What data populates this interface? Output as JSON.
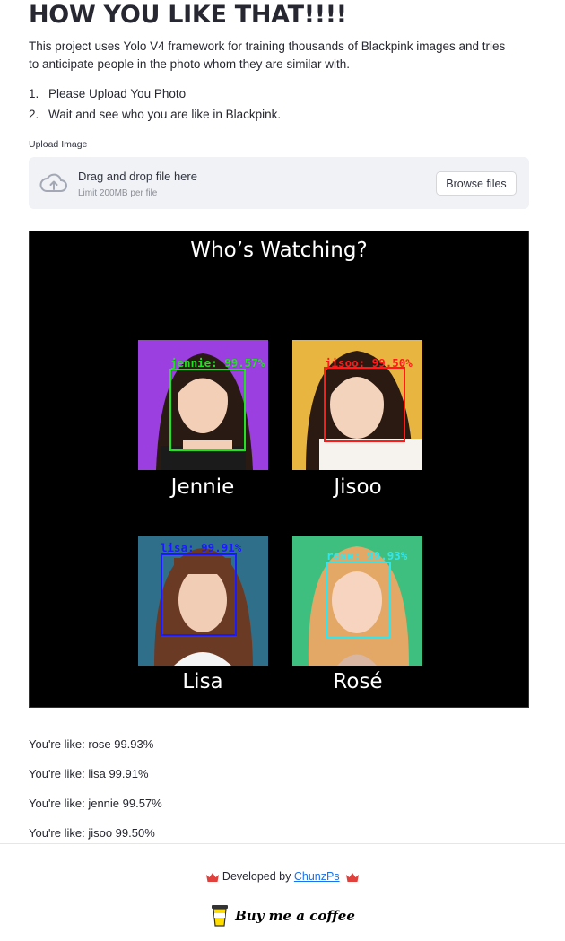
{
  "header": {
    "title": "HOW YOU LIKE THAT!!!!",
    "description": "This project uses Yolo V4 framework for training thousands of Blackpink images and tries to anticipate people in the photo whom they are similar with.",
    "steps": [
      {
        "num": "1.",
        "text": "Please Upload You Photo"
      },
      {
        "num": "2.",
        "text": "Wait and see who you are like in Blackpink."
      }
    ]
  },
  "uploader": {
    "label": "Upload Image",
    "drag_text": "Drag and drop file here",
    "limit_text": "Limit 200MB per file",
    "browse_label": "Browse files",
    "icon": "cloud-upload-icon"
  },
  "result_image": {
    "title": "Who’s Watching?",
    "tiles": [
      {
        "name": "Jennie",
        "label": "jennie: 99.57%",
        "color": "#22e022",
        "bg": "#9b3fe0"
      },
      {
        "name": "Jisoo",
        "label": "jisoo: 99.50%",
        "color": "#ff1a1a",
        "bg": "#e8b640"
      },
      {
        "name": "Lisa",
        "label": "lisa: 99.91%",
        "color": "#1a1aff",
        "bg": "#2f6f8a"
      },
      {
        "name": "Rosé",
        "label": "rose: 99.93%",
        "color": "#33e6ee",
        "bg": "#3fbf7f"
      }
    ]
  },
  "results": [
    "You're like: rose 99.93%",
    "You're like: lisa 99.91%",
    "You're like: jennie 99.57%",
    "You're like: jisoo 99.50%"
  ],
  "footer": {
    "developed_by": "Developed by",
    "author_link": "ChunzPs",
    "coffee_text": "Buy me a coffee",
    "crown_color": "#e0413c"
  }
}
